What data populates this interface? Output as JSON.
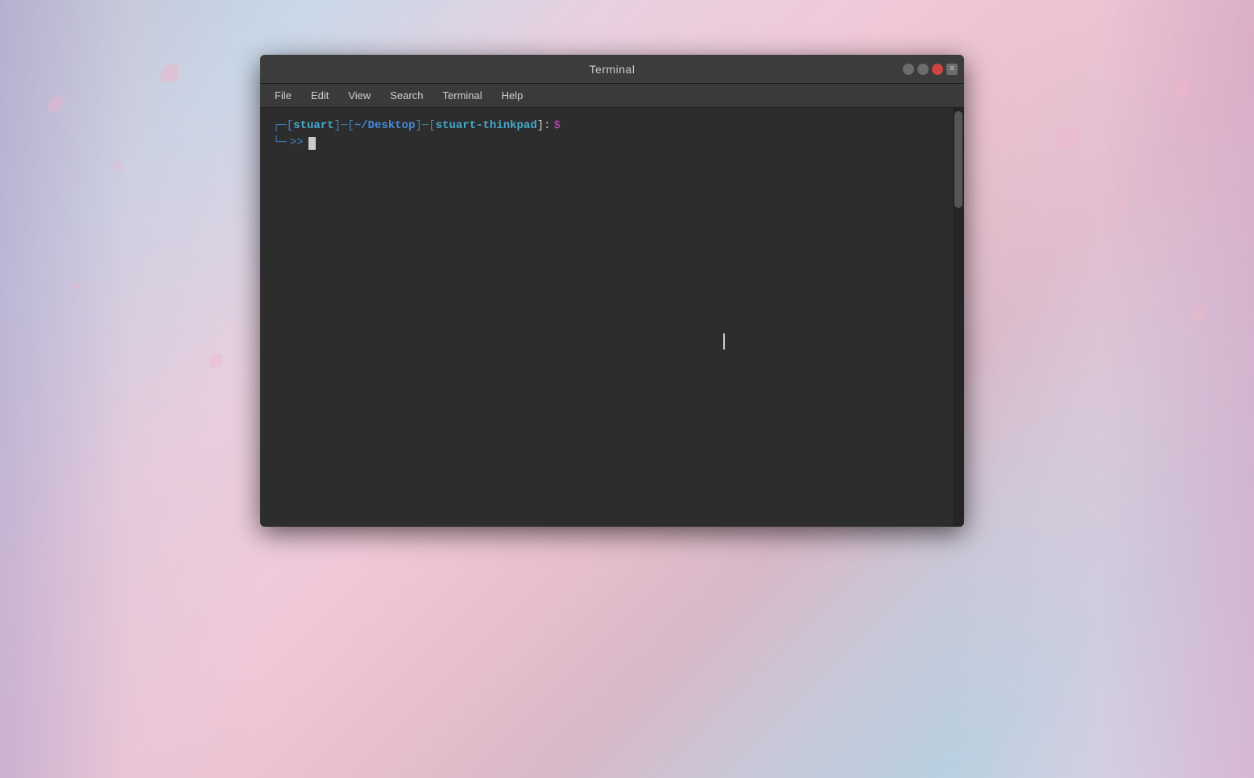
{
  "background": {
    "description": "Anime-style background with cherry blossoms"
  },
  "window": {
    "title": "Terminal",
    "controls": {
      "minimize_label": "−",
      "maximize_label": "□",
      "close_label": "×",
      "menu_label": "≡"
    }
  },
  "menu": {
    "items": [
      {
        "id": "file",
        "label": "File"
      },
      {
        "id": "edit",
        "label": "Edit"
      },
      {
        "id": "view",
        "label": "View"
      },
      {
        "id": "search",
        "label": "Search"
      },
      {
        "id": "terminal",
        "label": "Terminal"
      },
      {
        "id": "help",
        "label": "Help"
      }
    ]
  },
  "terminal": {
    "prompt": {
      "user": "stuart",
      "path": "~/Desktop",
      "host": "stuart-thinkpad",
      "dollar": "$"
    },
    "line1_parts": {
      "open_bracket": "┌─[",
      "user": "stuart",
      "sep1": "]─[",
      "path": "~/Desktop",
      "sep2": "]─[",
      "host": "stuart-thinkpad",
      "close": "]:",
      "dollar": " $"
    },
    "line2_parts": {
      "indent": "└─",
      "arrow": ">>",
      "cursor": ""
    }
  }
}
